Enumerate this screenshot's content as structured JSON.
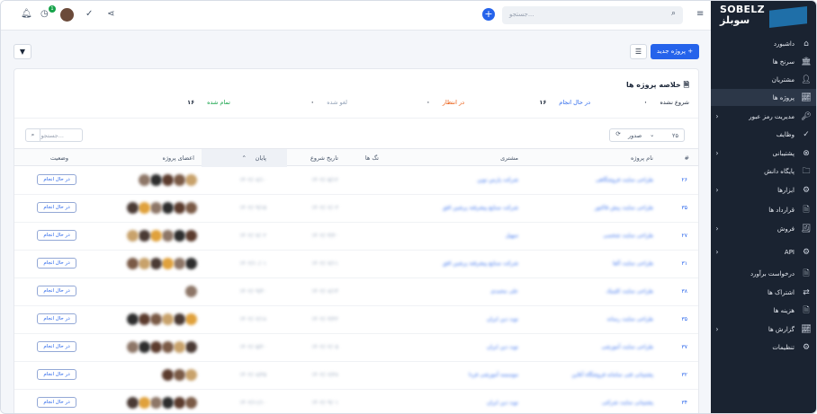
{
  "brand": {
    "name_en": "SOBELZ",
    "name_fa": "سوبلز"
  },
  "topbar": {
    "search_placeholder": "جستجو...",
    "notification_count": "1"
  },
  "sidebar": {
    "items": [
      {
        "label": "داشبورد",
        "icon": "home-icon",
        "chev": false
      },
      {
        "label": "سرنخ ها",
        "icon": "bank-icon",
        "chev": false
      },
      {
        "label": "مشتریان",
        "icon": "user-icon",
        "chev": false
      },
      {
        "label": "پروژه ها",
        "icon": "chart-icon",
        "chev": false,
        "active": true
      },
      {
        "label": "مدیریت رمز عبور",
        "icon": "key-icon",
        "chev": true
      },
      {
        "label": "وظایف",
        "icon": "check-circle-icon",
        "chev": false
      },
      {
        "label": "پشتیبانی",
        "icon": "support-icon",
        "chev": true
      },
      {
        "label": "پایگاه دانش",
        "icon": "folder-icon",
        "chev": false
      },
      {
        "label": "ابزارها",
        "icon": "gears-icon",
        "chev": true
      },
      {
        "label": "قرارداد ها",
        "icon": "file-icon",
        "chev": false
      },
      {
        "label": "فروش",
        "icon": "receipt-icon",
        "chev": true
      },
      {
        "label": "API",
        "icon": "gears-icon",
        "chev": true
      },
      {
        "label": "درخواست برآورد",
        "icon": "file-icon",
        "chev": false
      },
      {
        "label": "اشتراک ها",
        "icon": "repeat-icon",
        "chev": false
      },
      {
        "label": "هزینه ها",
        "icon": "file-icon",
        "chev": false
      },
      {
        "label": "گزارش ها",
        "icon": "chart-icon",
        "chev": true
      },
      {
        "label": "تنظیمات",
        "icon": "gear-icon",
        "chev": false
      }
    ]
  },
  "toolbar": {
    "new_project": "پروژه جدید"
  },
  "summary": {
    "title": "خلاصه پروژه ها",
    "stats": [
      {
        "label": "شروع نشده",
        "value": "۰",
        "color": "#1e293b"
      },
      {
        "label": "در حال انجام",
        "value": "۱۶",
        "color": "#2563eb"
      },
      {
        "label": "در انتظار",
        "value": "۰",
        "color": "#ea580c"
      },
      {
        "label": "لغو شده",
        "value": "۰",
        "color": "#94a3b8"
      },
      {
        "label": "تمام شده",
        "value": "۱۶",
        "color": "#16a34a"
      }
    ]
  },
  "controls": {
    "page_size": "۲۵",
    "export_label": "صدور",
    "search_placeholder": "جستجو..."
  },
  "table": {
    "headers": [
      "#",
      "نام پروژه",
      "مشتری",
      "تگ ها",
      "تاریخ شروع",
      "پایان",
      "اعضای پروژه",
      "وضعیت"
    ],
    "rows": [
      {
        "id": "۲۶",
        "name": "طراحی سایت فروشگاهی",
        "client": "شرکت پارس نوین",
        "start": "۱۴۰۲/۰۵/۱۲",
        "end": "۱۴۰۲/۰۸/۱۰",
        "members": 5,
        "status": "در حال انجام"
      },
      {
        "id": "۳۵",
        "name": "طراحی سایت پیش فاکتور",
        "client": "شرکت صنایع پیشرفته پرشین افق",
        "start": "۱۴۰۲/۰۶/۰۳",
        "end": "۱۴۰۲/۰۹/۱۵",
        "members": 6,
        "status": "در حال انجام"
      },
      {
        "id": "۲۷",
        "name": "طراحی سایت شخصی",
        "client": "سهیل",
        "start": "۱۴۰۲/۰۴/۲۰",
        "end": "۱۴۰۲/۰۷/۰۲",
        "members": 6,
        "status": "در حال انجام"
      },
      {
        "id": "۳۱",
        "name": "طراحی سایت آلفا",
        "client": "شرکت صنایع پیشرفته پرشین افق",
        "start": "۱۴۰۲/۰۷/۱۱",
        "end": "۱۴۰۲/۱۰/۰۱",
        "members": 6,
        "status": "در حال انجام"
      },
      {
        "id": "۳۸",
        "name": "طراحی سایت کلینیک",
        "client": "علی محمدی",
        "start": "۱۴۰۲/۰۸/۱۴",
        "end": "۱۴۰۲/۰۹/۳۰",
        "members": 1,
        "status": "در حال انجام"
      },
      {
        "id": "۳۵",
        "name": "طراحی سایت رسانه",
        "client": "نوید دین ایران",
        "start": "۱۴۰۲/۰۳/۲۲",
        "end": "۱۴۰۲/۰۶/۱۸",
        "members": 6,
        "status": "در حال انجام"
      },
      {
        "id": "۳۷",
        "name": "طراحی سایت آموزشی",
        "client": "نوید دین ایران",
        "start": "۱۴۰۲/۰۲/۰۵",
        "end": "۱۴۰۲/۰۵/۲۰",
        "members": 6,
        "status": "در حال انجام"
      },
      {
        "id": "۳۲",
        "name": "پشتیبانی فنی سامانه فروشگاه آنلاین",
        "client": "موسسه آموزشی فردا",
        "start": "۱۴۰۲/۰۶/۲۸",
        "end": "۱۴۰۲/۰۸/۲۵",
        "members": 3,
        "status": "در حال انجام"
      },
      {
        "id": "۳۴",
        "name": "پشتیبانی سایت شرکتی",
        "client": "نوید دین ایران",
        "start": "۱۴۰۲/۰۹/۰۱",
        "end": "۱۴۰۲/۱۱/۱۰",
        "members": 6,
        "status": "در حال انجام"
      }
    ]
  }
}
